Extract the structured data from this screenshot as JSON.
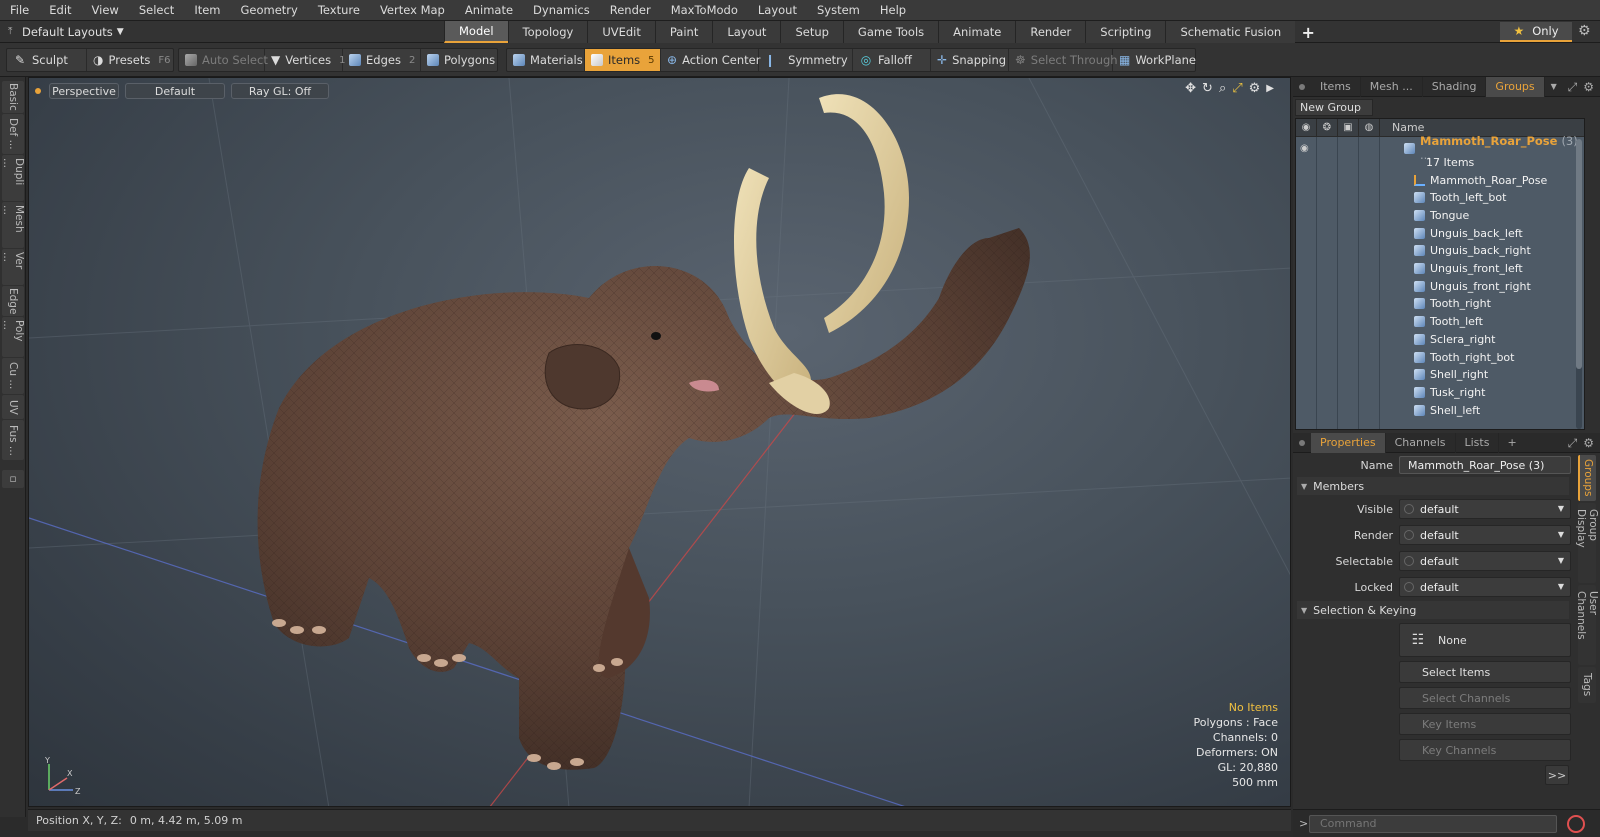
{
  "menu": [
    "File",
    "Edit",
    "View",
    "Select",
    "Item",
    "Geometry",
    "Texture",
    "Vertex Map",
    "Animate",
    "Dynamics",
    "Render",
    "MaxToModo",
    "Layout",
    "System",
    "Help"
  ],
  "layouts": {
    "label": "Default Layouts"
  },
  "tabs": [
    "Model",
    "Topology",
    "UVEdit",
    "Paint",
    "Layout",
    "Setup",
    "Game Tools",
    "Animate",
    "Render",
    "Scripting",
    "Schematic Fusion"
  ],
  "active_tab": "Model",
  "only": {
    "label": "Only"
  },
  "toolbar": {
    "sculpt": "Sculpt",
    "presets": "Presets",
    "presets_key": "F6",
    "auto_select": "Auto Select",
    "vertices": "Vertices",
    "vertices_key": "1",
    "edges": "Edges",
    "edges_key": "2",
    "polygons": "Polygons",
    "materials": "Materials",
    "items": "Items",
    "items_key": "5",
    "action_center": "Action Center",
    "symmetry": "Symmetry",
    "falloff": "Falloff",
    "snapping": "Snapping",
    "select_through": "Select Through",
    "workplane": "WorkPlane"
  },
  "left_tabs": [
    "Basic",
    "Def ...",
    "Dupli ...",
    "Mesh ...",
    "Ver ...",
    "Edge",
    "Poly ...",
    "Cu ...",
    "UV",
    "Fus ..."
  ],
  "viewport": {
    "view": "Perspective",
    "shading": "Default",
    "raygl": "Ray GL: Off",
    "stats": {
      "items": "No Items",
      "polygons": "Polygons : Face",
      "channels": "Channels: 0",
      "deformers": "Deformers: ON",
      "gl": "GL: 20,880",
      "scale": "500 mm"
    },
    "axis_y": "Y",
    "axis_x": "X",
    "axis_z": "Z"
  },
  "status": {
    "label": "Position X, Y, Z:",
    "value": "0 m, 4.42 m, 5.09 m"
  },
  "panel_tabs": [
    "Items",
    "Mesh ...",
    "Shading",
    "Groups"
  ],
  "active_panel_tab": "Groups",
  "new_group": "New Group",
  "group_list": {
    "header_name": "Name",
    "group": {
      "name": "Mammoth_Roar_Pose",
      "count": "(3) ...",
      "sub": "17 Items"
    },
    "items": [
      "Mammoth_Roar_Pose",
      "Tooth_left_bot",
      "Tongue",
      "Unguis_back_left",
      "Unguis_back_right",
      "Unguis_front_left",
      "Unguis_front_right",
      "Tooth_right",
      "Tooth_left",
      "Sclera_right",
      "Tooth_right_bot",
      "Shell_right",
      "Tusk_right",
      "Shell_left"
    ]
  },
  "prop_tabs": [
    "Properties",
    "Channels",
    "Lists"
  ],
  "properties": {
    "name_label": "Name",
    "name_value": "Mammoth_Roar_Pose (3)",
    "members": "Members",
    "visible_label": "Visible",
    "render_label": "Render",
    "selectable_label": "Selectable",
    "locked_label": "Locked",
    "dd_value": "default",
    "sel_keying": "Selection & Keying",
    "none": "None",
    "select_items": "Select Items",
    "select_channels": "Select Channels",
    "key_items": "Key Items",
    "key_channels": "Key Channels",
    "more": ">>"
  },
  "vtabs": [
    "Groups",
    "Group Display",
    "User Channels",
    "Tags"
  ],
  "command": {
    "placeholder": "Command"
  },
  "colors": {
    "accent": "#e9a33a",
    "list_bg": "#4e5a66"
  }
}
